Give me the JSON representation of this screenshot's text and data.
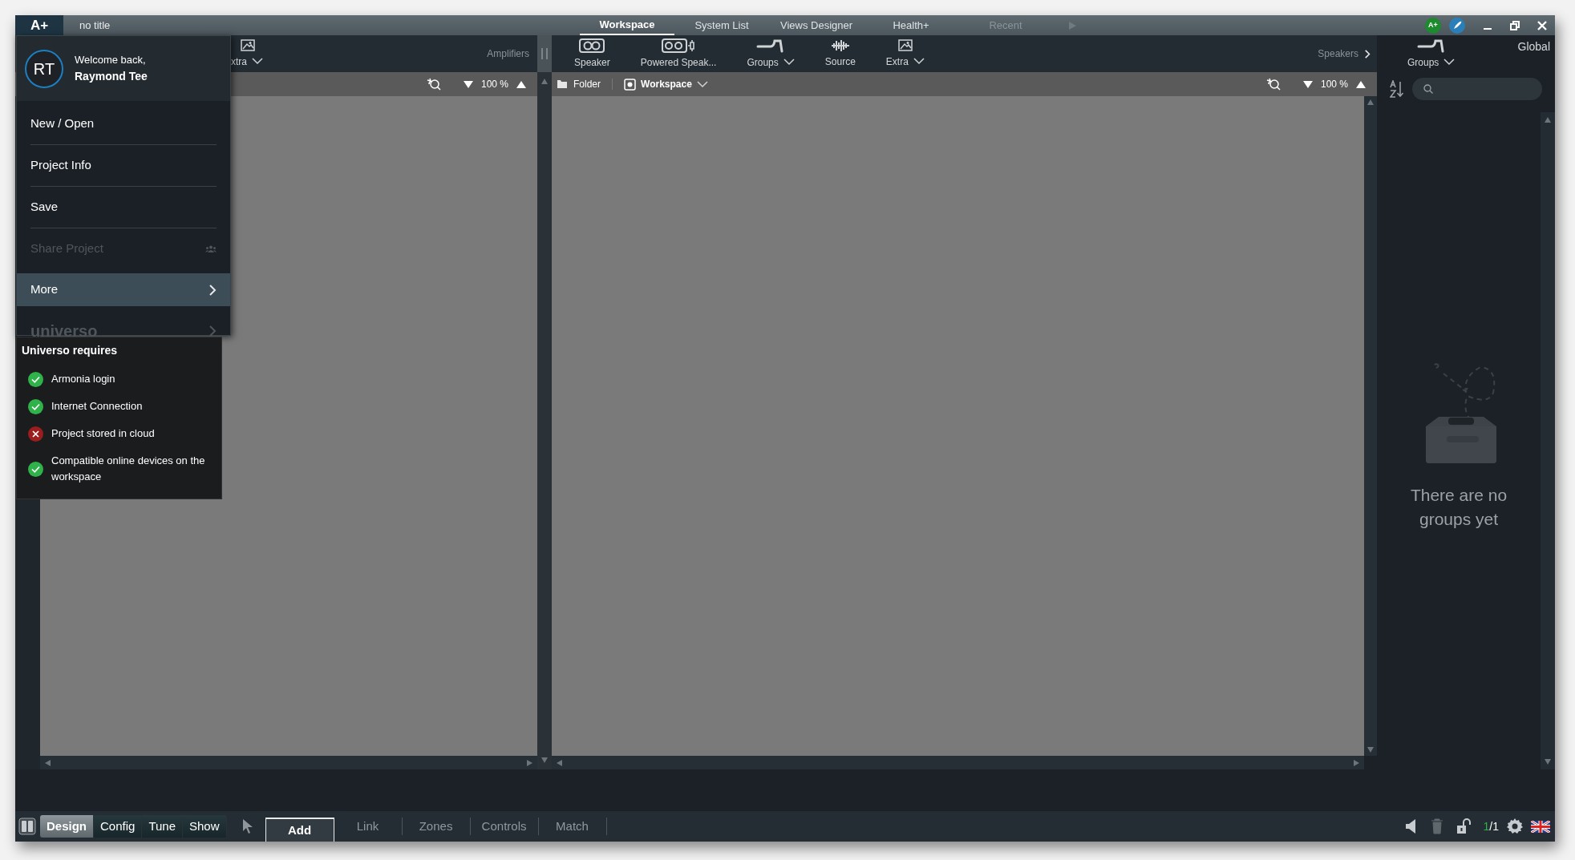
{
  "title_bar": {
    "logo": "A+",
    "document_title": "no title",
    "tabs": [
      {
        "label": "Workspace",
        "selected": true,
        "disabled": false
      },
      {
        "label": "System List",
        "selected": false,
        "disabled": false
      },
      {
        "label": "Views Designer",
        "selected": false,
        "disabled": false
      },
      {
        "label": "Health+",
        "selected": false,
        "disabled": false
      },
      {
        "label": "Recent",
        "selected": false,
        "disabled": true
      }
    ],
    "status_badge": "A+"
  },
  "amplifiers_toolbar": {
    "items": [
      {
        "label": "xtra",
        "kind": "extra",
        "dropdown": true
      }
    ],
    "section_label": "Amplifiers"
  },
  "amplifiers_canvas": {
    "zoom": "100 %"
  },
  "speakers_toolbar": {
    "items": [
      {
        "label": "Speaker",
        "kind": "speaker",
        "dropdown": false
      },
      {
        "label": "Powered Speak...",
        "kind": "powered",
        "dropdown": false
      },
      {
        "label": "Groups",
        "kind": "groups",
        "dropdown": true
      },
      {
        "label": "Source",
        "kind": "source",
        "dropdown": false
      },
      {
        "label": "Extra",
        "kind": "extra",
        "dropdown": true
      }
    ],
    "section_label": "Speakers"
  },
  "workspace_canvas": {
    "folder": "Folder",
    "view": "Workspace",
    "zoom": "100 %"
  },
  "groups_panel": {
    "groups_button": "Groups",
    "title": "Global",
    "empty_message": "There are no groups yet"
  },
  "user_menu": {
    "initials": "RT",
    "greeting": "Welcome back,",
    "name": "Raymond Tee",
    "items": [
      {
        "label": "New / Open",
        "kind": "plain",
        "disabled": false,
        "selected": false
      },
      {
        "label": "Project Info",
        "kind": "plain",
        "disabled": false,
        "selected": false
      },
      {
        "label": "Save",
        "kind": "plain",
        "disabled": false,
        "selected": false
      },
      {
        "label": "Share Project",
        "kind": "share",
        "disabled": true,
        "selected": false
      },
      {
        "label": "More",
        "kind": "submenu",
        "disabled": false,
        "selected": true
      },
      {
        "label": "universo",
        "kind": "logo",
        "disabled": true,
        "selected": false
      }
    ]
  },
  "universo_requirements": {
    "title": "Universo requires",
    "items": [
      {
        "label": "Armonia login",
        "met": true
      },
      {
        "label": "Internet Connection",
        "met": true
      },
      {
        "label": "Project stored in cloud",
        "met": false
      },
      {
        "label": "Compatible online devices on the workspace",
        "met": true
      }
    ]
  },
  "bottom_bar": {
    "modes": [
      {
        "label": "Design",
        "selected": true
      },
      {
        "label": "Config",
        "selected": false
      },
      {
        "label": "Tune",
        "selected": false
      },
      {
        "label": "Show",
        "selected": false
      }
    ],
    "tools": [
      {
        "label": "Add",
        "selected": true
      },
      {
        "label": "Link",
        "selected": false
      },
      {
        "label": "Zones",
        "selected": false
      },
      {
        "label": "Controls",
        "selected": false
      },
      {
        "label": "Match",
        "selected": false
      }
    ],
    "page_current": "1",
    "page_total": "/1"
  }
}
